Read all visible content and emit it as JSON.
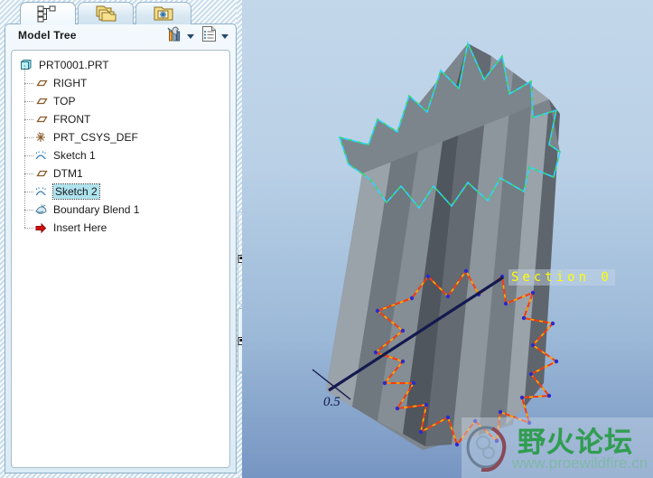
{
  "window": {
    "tabs": [
      {
        "name": "model-tree-tab",
        "icon": "model-tree-icon",
        "active": true
      },
      {
        "name": "layer-tree-tab",
        "icon": "layers-folders-icon",
        "active": false
      },
      {
        "name": "folder-browser-tab",
        "icon": "folder-star-icon",
        "active": false
      }
    ]
  },
  "panel": {
    "title": "Model Tree",
    "toolbar": [
      {
        "name": "settings-tools-button",
        "icon": "tools-icon",
        "has_caret": true
      },
      {
        "name": "tree-display-button",
        "icon": "list-settings-icon",
        "has_caret": true
      }
    ]
  },
  "tree": {
    "root": {
      "label": "PRT0001.PRT",
      "icon": "part-icon"
    },
    "items": [
      {
        "label": "RIGHT",
        "icon": "datum-plane-icon",
        "selected": false
      },
      {
        "label": "TOP",
        "icon": "datum-plane-icon",
        "selected": false
      },
      {
        "label": "FRONT",
        "icon": "datum-plane-icon",
        "selected": false
      },
      {
        "label": "PRT_CSYS_DEF",
        "icon": "coordinate-system-icon",
        "selected": false
      },
      {
        "label": "Sketch 1",
        "icon": "sketch-icon",
        "selected": false
      },
      {
        "label": "DTM1",
        "icon": "datum-plane-icon",
        "selected": false
      },
      {
        "label": "Sketch 2",
        "icon": "sketch-icon",
        "selected": true
      },
      {
        "label": "Boundary Blend 1",
        "icon": "boundary-blend-icon",
        "selected": false
      },
      {
        "label": "Insert Here",
        "icon": "insert-here-arrow-icon",
        "selected": false
      }
    ]
  },
  "viewport": {
    "section_label": "Section 0",
    "dimension_label": "0.5",
    "colors": {
      "background_top": "#c3d7ea",
      "background_bottom": "#7795c2",
      "top_section_edge": "#2bd6ff",
      "top_section_dash": "#3bd95a",
      "bottom_section_edge": "#f23c12",
      "bottom_section_dash": "#ffae00",
      "vertex_point": "#2b2bcc",
      "centerline": "#131a4e",
      "section_text": "#ffff00"
    }
  },
  "watermark": {
    "title": "野火论坛",
    "url": "www.proewildfire.cn",
    "logo": "ring-logo-icon"
  }
}
